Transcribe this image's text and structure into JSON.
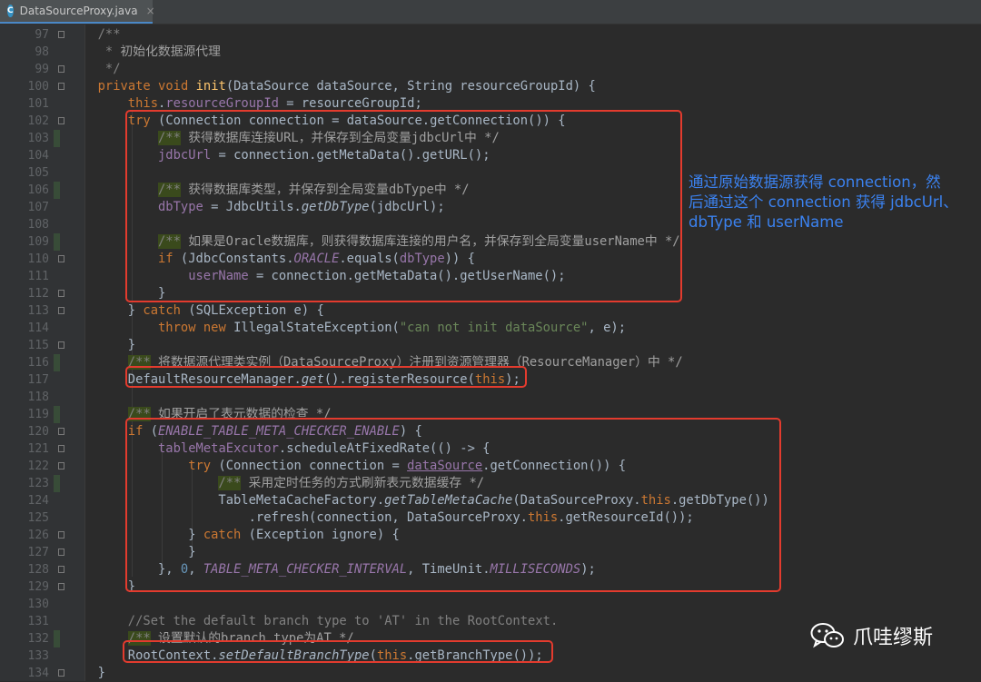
{
  "tab": {
    "icon_letter": "C",
    "label": "DataSourceProxy.java",
    "close": "×"
  },
  "lines": [
    {
      "n": "97",
      "i": 2,
      "f": true,
      "c": false,
      "t": [
        [
          "/**",
          "cm"
        ]
      ]
    },
    {
      "n": "98",
      "i": 2,
      "f": false,
      "c": false,
      "t": [
        [
          " * ",
          "cm"
        ],
        [
          "初始化数据源代理",
          "cmc"
        ]
      ]
    },
    {
      "n": "99",
      "i": 2,
      "f": true,
      "c": false,
      "t": [
        [
          " */",
          "cm"
        ]
      ]
    },
    {
      "n": "100",
      "i": 2,
      "f": true,
      "c": false,
      "t": [
        [
          "private void ",
          "kw"
        ],
        [
          "init",
          "fn"
        ],
        [
          "(DataSource dataSource, String resourceGroupId) {",
          ""
        ]
      ]
    },
    {
      "n": "101",
      "i": 6,
      "f": false,
      "c": false,
      "t": [
        [
          "this",
          "kw"
        ],
        [
          ".",
          ""
        ],
        [
          "resourceGroupId",
          "fld"
        ],
        [
          " = resourceGroupId;",
          ""
        ]
      ]
    },
    {
      "n": "102",
      "i": 6,
      "f": true,
      "c": false,
      "t": [
        [
          "try ",
          "kw"
        ],
        [
          "(Connection connection = dataSource.getConnection()) {",
          ""
        ]
      ]
    },
    {
      "n": "103",
      "i": 10,
      "f": false,
      "c": true,
      "t": [
        [
          "/**",
          "cm cmh"
        ],
        [
          " ",
          ""
        ],
        [
          "获得数据库连接URL，并保存到全局变量jdbcUrl中 */",
          "cmc"
        ]
      ]
    },
    {
      "n": "104",
      "i": 10,
      "f": false,
      "c": false,
      "t": [
        [
          "jdbcUrl",
          "fld"
        ],
        [
          " = connection.getMetaData().getURL();",
          ""
        ]
      ]
    },
    {
      "n": "105",
      "i": 10,
      "f": false,
      "c": false,
      "t": []
    },
    {
      "n": "106",
      "i": 10,
      "f": false,
      "c": true,
      "t": [
        [
          "/**",
          "cm cmh"
        ],
        [
          " ",
          ""
        ],
        [
          "获得数据库类型，并保存到全局变量dbType中 */",
          "cmc"
        ]
      ]
    },
    {
      "n": "107",
      "i": 10,
      "f": false,
      "c": false,
      "t": [
        [
          "dbType",
          "fld"
        ],
        [
          " = JdbcUtils.",
          ""
        ],
        [
          "getDbType",
          "it"
        ],
        [
          "(jdbcUrl);",
          ""
        ]
      ]
    },
    {
      "n": "108",
      "i": 10,
      "f": false,
      "c": false,
      "t": []
    },
    {
      "n": "109",
      "i": 10,
      "f": false,
      "c": true,
      "t": [
        [
          "/**",
          "cm cmh"
        ],
        [
          " ",
          ""
        ],
        [
          "如果是Oracle数据库，则获得数据库连接的用户名，并保存到全局变量userName中 */",
          "cmc"
        ]
      ]
    },
    {
      "n": "110",
      "i": 10,
      "f": true,
      "c": false,
      "t": [
        [
          "if ",
          "kw"
        ],
        [
          "(JdbcConstants.",
          ""
        ],
        [
          "ORACLE",
          "cst"
        ],
        [
          ".equals(",
          ""
        ],
        [
          "dbType",
          "fld"
        ],
        [
          ")) {",
          ""
        ]
      ]
    },
    {
      "n": "111",
      "i": 14,
      "f": false,
      "c": false,
      "t": [
        [
          "userName",
          "fld"
        ],
        [
          " = connection.getMetaData().getUserName();",
          ""
        ]
      ]
    },
    {
      "n": "112",
      "i": 10,
      "f": true,
      "c": false,
      "t": [
        [
          "}",
          ""
        ]
      ]
    },
    {
      "n": "113",
      "i": 6,
      "f": true,
      "c": false,
      "t": [
        [
          "} ",
          ""
        ],
        [
          "catch ",
          "kw"
        ],
        [
          "(SQLException e) {",
          ""
        ]
      ]
    },
    {
      "n": "114",
      "i": 10,
      "f": false,
      "c": false,
      "t": [
        [
          "throw new ",
          "kw"
        ],
        [
          "IllegalStateException(",
          ""
        ],
        [
          "\"can not init dataSource\"",
          "str"
        ],
        [
          ", e);",
          ""
        ]
      ]
    },
    {
      "n": "115",
      "i": 6,
      "f": true,
      "c": false,
      "t": [
        [
          "}",
          ""
        ]
      ]
    },
    {
      "n": "116",
      "i": 6,
      "f": false,
      "c": true,
      "t": [
        [
          "/**",
          "cm cmh"
        ],
        [
          " ",
          ""
        ],
        [
          "将数据源代理类实例（DataSourceProxy）注册到资源管理器（ResourceManager）中 */",
          "cmc"
        ]
      ]
    },
    {
      "n": "117",
      "i": 6,
      "f": false,
      "c": false,
      "t": [
        [
          "DefaultResourceManager.",
          ""
        ],
        [
          "get",
          "it"
        ],
        [
          "().registerResource(",
          ""
        ],
        [
          "this",
          "kw"
        ],
        [
          ");",
          ""
        ]
      ]
    },
    {
      "n": "118",
      "i": 6,
      "f": false,
      "c": false,
      "t": []
    },
    {
      "n": "119",
      "i": 6,
      "f": false,
      "c": true,
      "t": [
        [
          "/**",
          "cm cmh"
        ],
        [
          " ",
          ""
        ],
        [
          "如果开启了表元数据的检查 */",
          "cmc"
        ]
      ]
    },
    {
      "n": "120",
      "i": 6,
      "f": true,
      "c": false,
      "t": [
        [
          "if ",
          "kw"
        ],
        [
          "(",
          ""
        ],
        [
          "ENABLE_TABLE_META_CHECKER_ENABLE",
          "cst"
        ],
        [
          ") {",
          ""
        ]
      ]
    },
    {
      "n": "121",
      "i": 10,
      "f": true,
      "c": false,
      "t": [
        [
          "tableMetaExcutor",
          "fld"
        ],
        [
          ".scheduleAtFixedRate(() -> {",
          ""
        ]
      ]
    },
    {
      "n": "122",
      "i": 14,
      "f": true,
      "c": false,
      "t": [
        [
          "try ",
          "kw"
        ],
        [
          "(Connection connection = ",
          ""
        ],
        [
          "dataSource",
          "fld ul"
        ],
        [
          ".getConnection()) {",
          ""
        ]
      ]
    },
    {
      "n": "123",
      "i": 18,
      "f": false,
      "c": true,
      "t": [
        [
          "/**",
          "cm cmh"
        ],
        [
          " ",
          ""
        ],
        [
          "采用定时任务的方式刷新表元数据缓存 */",
          "cmc"
        ]
      ]
    },
    {
      "n": "124",
      "i": 18,
      "f": false,
      "c": false,
      "t": [
        [
          "TableMetaCacheFactory.",
          ""
        ],
        [
          "getTableMetaCache",
          "it"
        ],
        [
          "(DataSourceProxy.",
          ""
        ],
        [
          "this",
          "kw"
        ],
        [
          ".getDbType())",
          ""
        ]
      ]
    },
    {
      "n": "125",
      "i": 22,
      "f": false,
      "c": false,
      "t": [
        [
          ".refresh(connection, DataSourceProxy.",
          ""
        ],
        [
          "this",
          "kw"
        ],
        [
          ".getResourceId());",
          ""
        ]
      ]
    },
    {
      "n": "126",
      "i": 14,
      "f": true,
      "c": false,
      "t": [
        [
          "} ",
          ""
        ],
        [
          "catch ",
          "kw"
        ],
        [
          "(Exception ignore) {",
          ""
        ]
      ]
    },
    {
      "n": "127",
      "i": 14,
      "f": true,
      "c": false,
      "t": [
        [
          "}",
          ""
        ]
      ]
    },
    {
      "n": "128",
      "i": 10,
      "f": true,
      "c": false,
      "t": [
        [
          "}, ",
          ""
        ],
        [
          "0",
          "num"
        ],
        [
          ", ",
          ""
        ],
        [
          "TABLE_META_CHECKER_INTERVAL",
          "cst"
        ],
        [
          ", TimeUnit.",
          ""
        ],
        [
          "MILLISECONDS",
          "cst"
        ],
        [
          ");",
          ""
        ]
      ]
    },
    {
      "n": "129",
      "i": 6,
      "f": true,
      "c": false,
      "t": [
        [
          "}",
          ""
        ]
      ]
    },
    {
      "n": "130",
      "i": 6,
      "f": false,
      "c": false,
      "t": []
    },
    {
      "n": "131",
      "i": 6,
      "f": false,
      "c": false,
      "t": [
        [
          "//Set the default branch type to 'AT' in the RootContext.",
          "cm"
        ]
      ]
    },
    {
      "n": "132",
      "i": 6,
      "f": false,
      "c": true,
      "t": [
        [
          "/**",
          "cm cmh"
        ],
        [
          " ",
          ""
        ],
        [
          "设置默认的branch type为AT */",
          "cmc"
        ]
      ]
    },
    {
      "n": "133",
      "i": 6,
      "f": false,
      "c": false,
      "t": [
        [
          "RootContext.",
          ""
        ],
        [
          "setDefaultBranchType",
          "it"
        ],
        [
          "(",
          ""
        ],
        [
          "this",
          "kw"
        ],
        [
          ".getBranchType());",
          ""
        ]
      ]
    },
    {
      "n": "134",
      "i": 2,
      "f": true,
      "c": false,
      "t": [
        [
          "}",
          ""
        ]
      ]
    }
  ],
  "annotation": {
    "line1": "通过原始数据源获得 connection，然",
    "line2": "后通过这个 connection 获得 jdbcUrl、",
    "line3": "dbType 和 userName"
  },
  "watermark": {
    "text": "爪哇缪斯",
    "icon": "wechat-icon"
  },
  "colors": {
    "highlight_box": "#e33b2e",
    "annotation": "#3b82f0",
    "background": "#2b2b2b"
  }
}
